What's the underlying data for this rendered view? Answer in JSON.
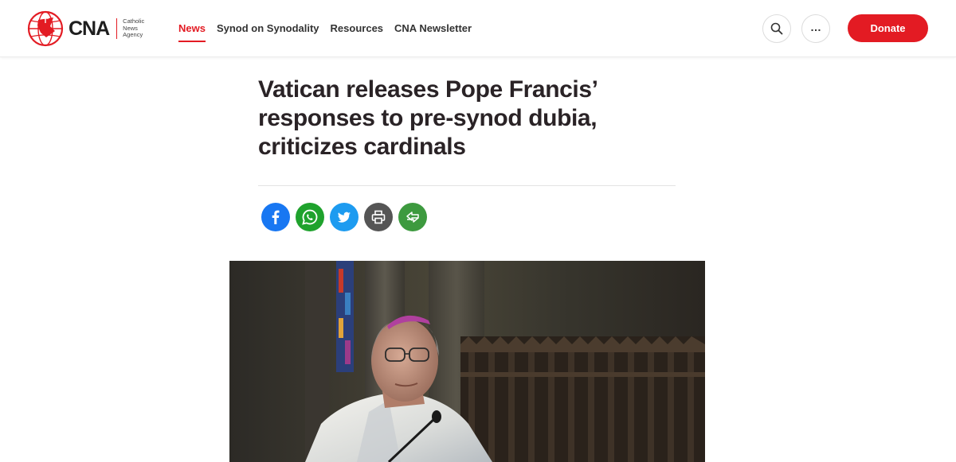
{
  "brand": {
    "logo_text": "CNA",
    "logo_subtitle": [
      "Catholic",
      "News",
      "Agency"
    ],
    "accent_color": "#e31b23"
  },
  "nav": {
    "items": [
      {
        "label": "News",
        "active": true
      },
      {
        "label": "Synod on Synodality",
        "active": false
      },
      {
        "label": "Resources",
        "active": false
      },
      {
        "label": "CNA Newsletter",
        "active": false
      }
    ]
  },
  "header_actions": {
    "search_icon": "search-icon",
    "more_icon": "more-dots-icon",
    "more_glyph": "…",
    "donate_label": "Donate"
  },
  "article": {
    "headline": "Vatican releases Pope Francis’ responses to pre-synod dubia, criticizes cardinals"
  },
  "share": {
    "buttons": [
      {
        "name": "facebook",
        "icon": "facebook-icon",
        "color": "#1877f2"
      },
      {
        "name": "whatsapp",
        "icon": "whatsapp-icon",
        "color": "#1fa22d"
      },
      {
        "name": "twitter",
        "icon": "twitter-icon",
        "color": "#1d9bf0"
      },
      {
        "name": "print",
        "icon": "print-icon",
        "color": "#555555"
      },
      {
        "name": "more",
        "icon": "share-more-icon",
        "color": "#3d9a3f"
      }
    ]
  }
}
